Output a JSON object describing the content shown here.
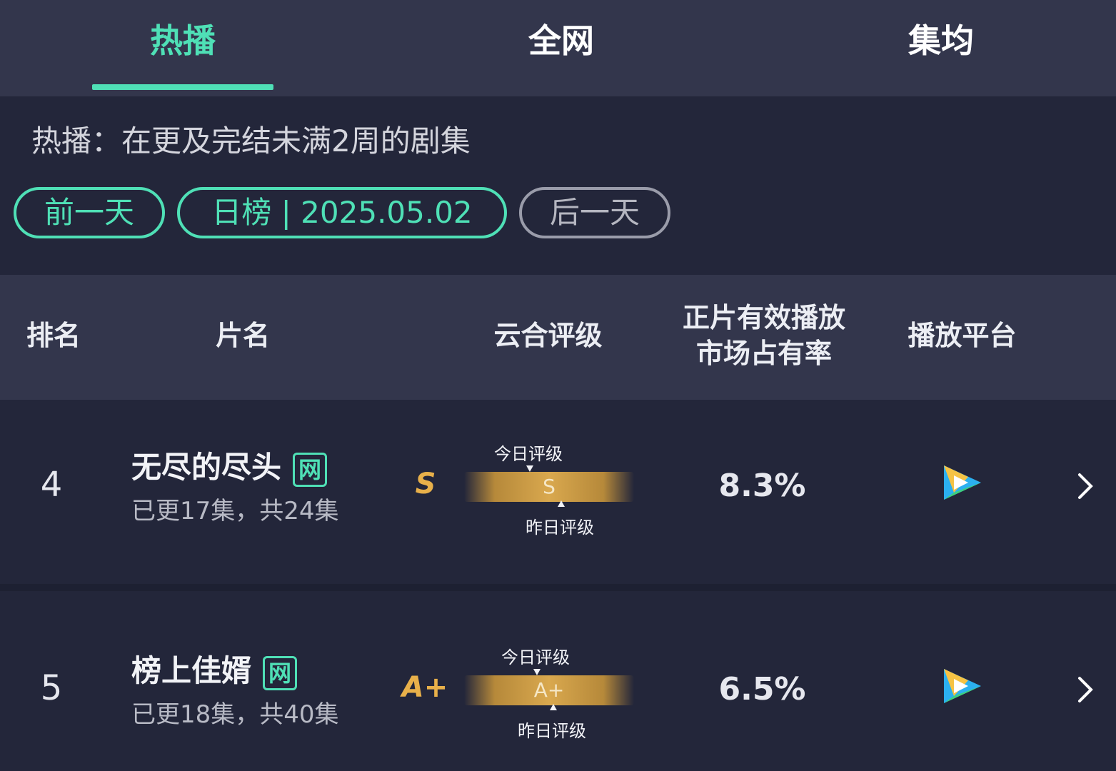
{
  "tabs": [
    {
      "label": "热播",
      "active": true
    },
    {
      "label": "全网",
      "active": false
    },
    {
      "label": "集均",
      "active": false
    }
  ],
  "description": "热播：在更及完结未满2周的剧集",
  "date_nav": {
    "prev_label": "前一天",
    "current_label": "日榜 | 2025.05.02",
    "next_label": "后一天"
  },
  "table": {
    "headers": {
      "rank": "排名",
      "title": "片名",
      "rating": "云合评级",
      "share_line1": "正片有效播放",
      "share_line2": "市场占有率",
      "platform": "播放平台"
    },
    "rows": [
      {
        "rank": "4",
        "title": "无尽的尽头",
        "badge": "网",
        "episodes": "已更17集，共24集",
        "grade": "S",
        "grade_bar": "S",
        "today_label": "今日评级",
        "yesterday_label": "昨日评级",
        "share": "8.3%",
        "platform_icon": "tencent-video-icon"
      },
      {
        "rank": "5",
        "title": "榜上佳婿",
        "badge": "网",
        "episodes": "已更18集，共40集",
        "grade": "A+",
        "grade_bar": "A+",
        "today_label": "今日评级",
        "yesterday_label": "昨日评级",
        "share": "6.5%",
        "platform_icon": "tencent-video-icon"
      }
    ]
  },
  "colors": {
    "accent": "#4fe0b6",
    "grade_gold": "#e8b04a",
    "background": "#23263a",
    "header_bg": "#33364c"
  }
}
